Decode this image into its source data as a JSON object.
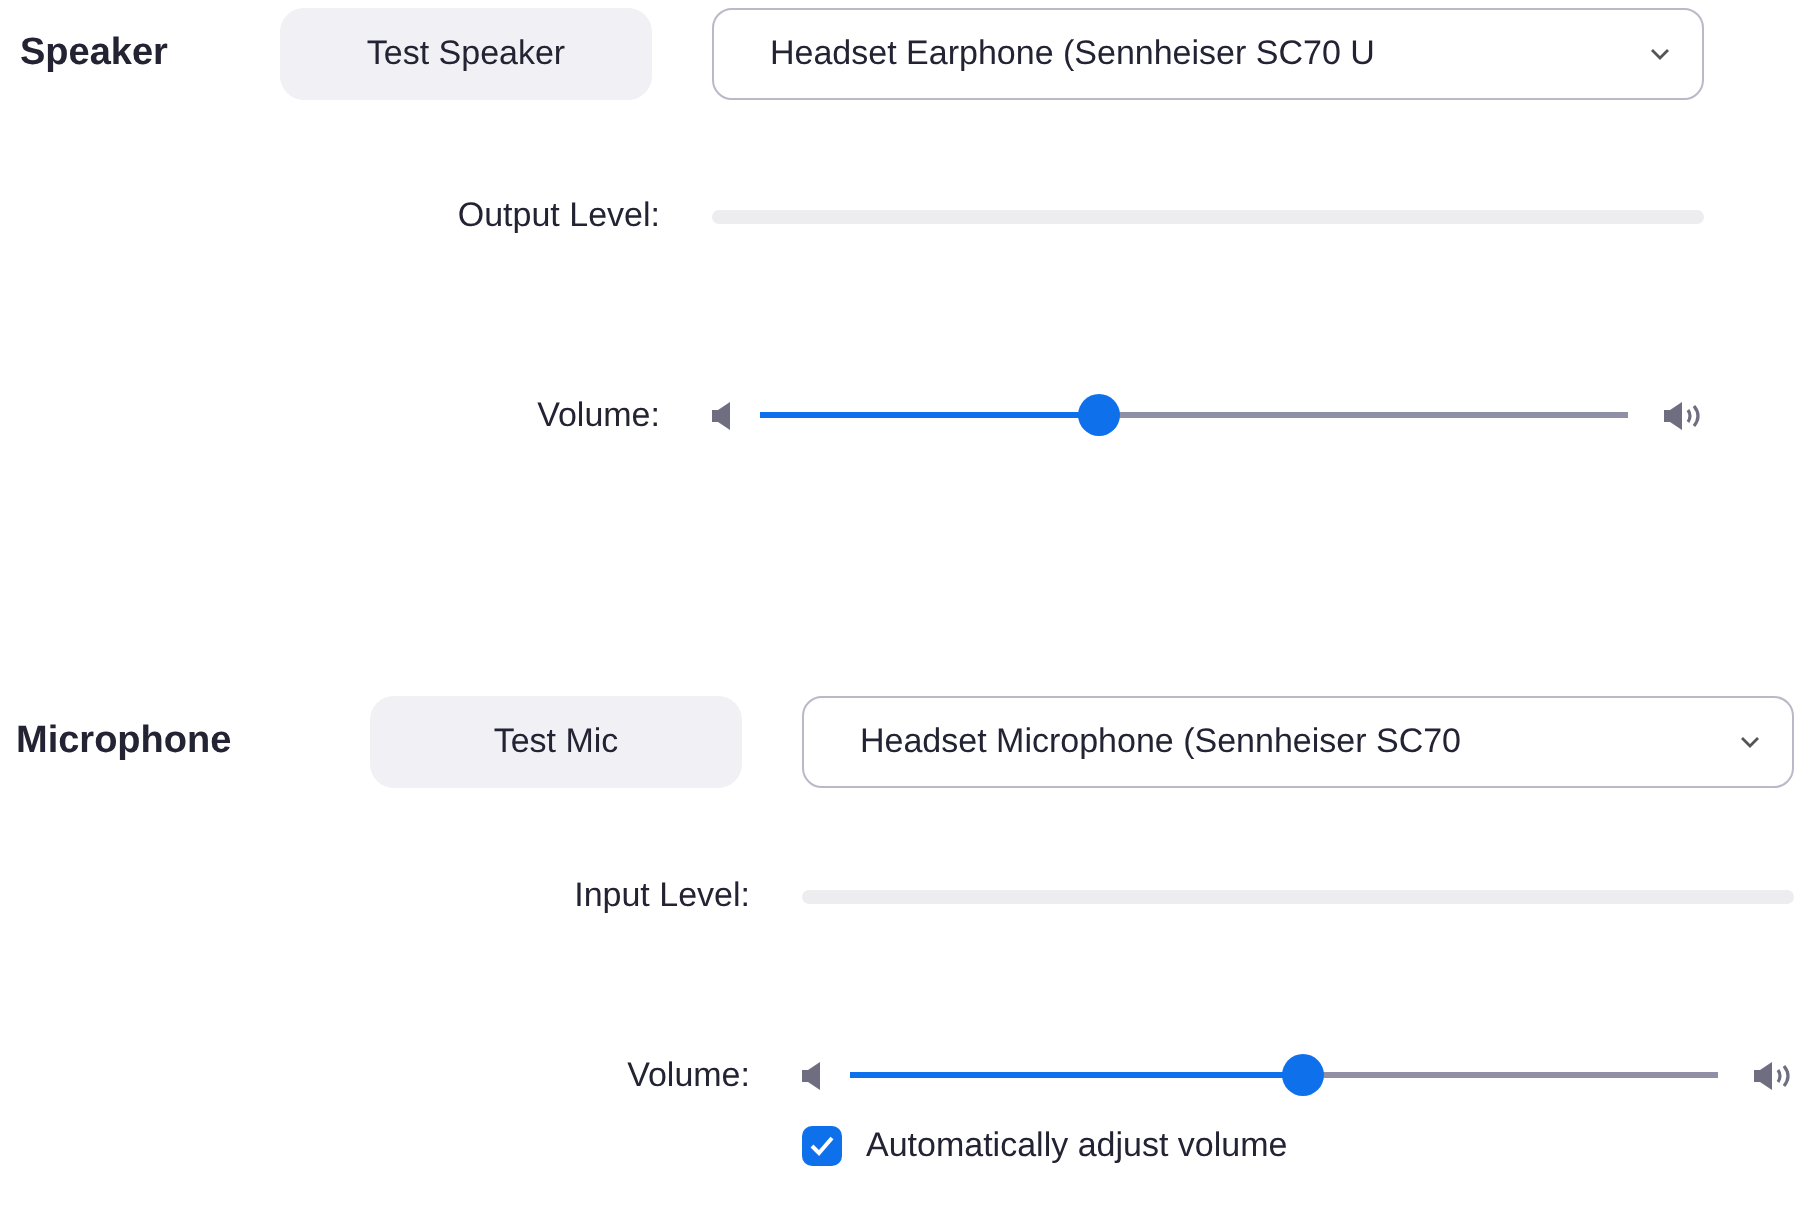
{
  "sections": [
    {
      "title": "Speaker",
      "test_button": "Test Speaker",
      "device": "Headset Earphone (Sennheiser SC70 U",
      "level_label": "Output Level:",
      "volume_label": "Volume:",
      "volume": {
        "level": 0.39
      }
    },
    {
      "title": "Microphone",
      "test_button": "Test Mic",
      "device": "Headset Microphone (Sennheiser SC70",
      "level_label": "Input Level:",
      "volume_label": "Volume:",
      "volume": {
        "level": 0.52
      },
      "auto_adjust": {
        "label": "Automatically adjust volume",
        "checked": true
      }
    }
  ]
}
